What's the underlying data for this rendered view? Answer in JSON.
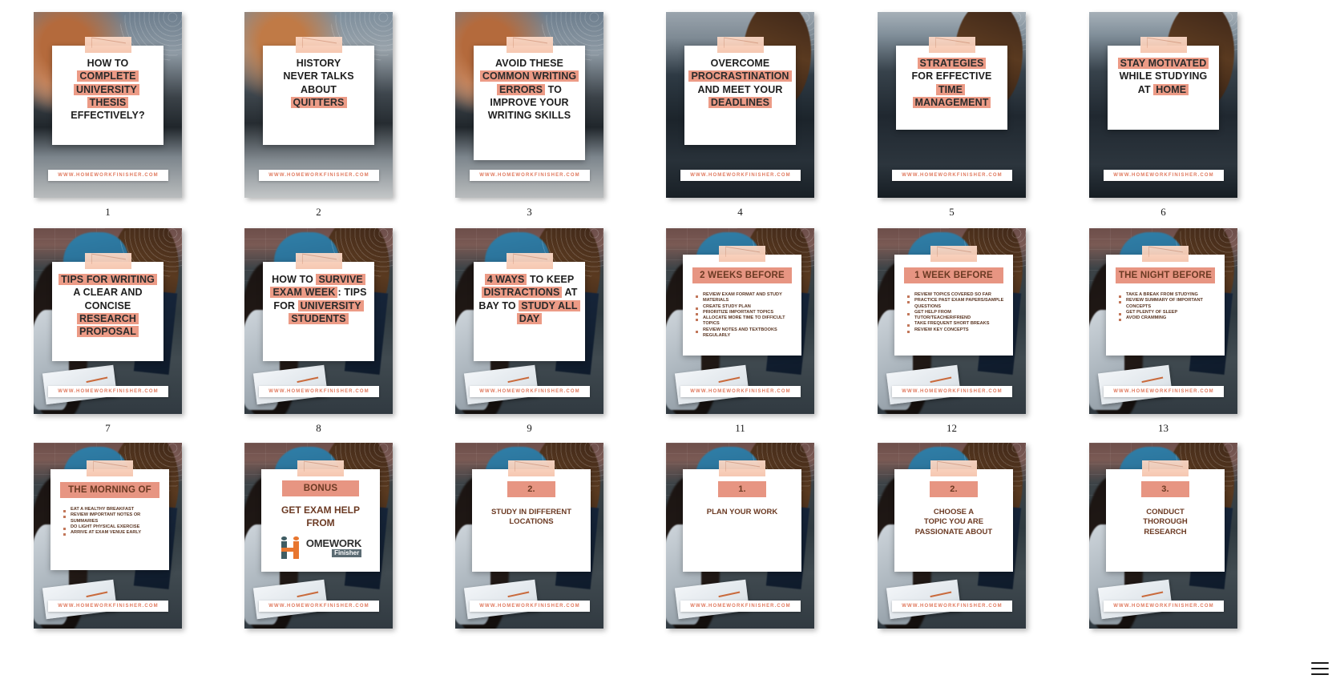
{
  "page": {
    "background": "#ffffff",
    "accent": "#e79582",
    "accent_text": "#6b3a23",
    "link_color": "#e07a5f",
    "menu_icon": "hamburger-icon"
  },
  "site_url": "WWW.HOMEWORKFINISHER.COM",
  "rows": [
    {
      "name": "row-1",
      "cards": [
        {
          "caption": "1",
          "style": "headline",
          "bg": "bg-desk",
          "lines": [
            [
              {
                "t": "HOW TO",
                "h": false
              }
            ],
            [
              {
                "t": "COMPLETE",
                "h": true
              }
            ],
            [
              {
                "t": "UNIVERSITY THESIS",
                "h": true
              }
            ],
            [
              {
                "t": "EFFECTIVELY?",
                "h": false
              }
            ]
          ]
        },
        {
          "caption": "2",
          "style": "headline",
          "bg": "bg-desk2",
          "lines": [
            [
              {
                "t": "HISTORY",
                "h": false
              }
            ],
            [
              {
                "t": "NEVER TALKS",
                "h": false
              }
            ],
            [
              {
                "t": "ABOUT",
                "h": false
              }
            ],
            [
              {
                "t": "QUITTERS",
                "h": true
              }
            ]
          ]
        },
        {
          "caption": "3",
          "style": "headline",
          "bg": "bg-desk",
          "lines": [
            [
              {
                "t": "AVOID THESE",
                "h": false
              }
            ],
            [
              {
                "t": "COMMON WRITING",
                "h": true
              }
            ],
            [
              {
                "t": "ERRORS",
                "h": true
              },
              {
                "t": " TO",
                "h": false
              }
            ],
            [
              {
                "t": "IMPROVE YOUR",
                "h": false
              }
            ],
            [
              {
                "t": "WRITING SKILLS",
                "h": false
              }
            ]
          ]
        },
        {
          "caption": "4",
          "style": "headline",
          "bg": "bg-street",
          "lines": [
            [
              {
                "t": "OVERCOME",
                "h": false
              }
            ],
            [
              {
                "t": "PROCRASTINATION",
                "h": true
              }
            ],
            [
              {
                "t": "AND MEET YOUR",
                "h": false
              }
            ],
            [
              {
                "t": "DEADLINES",
                "h": true
              }
            ]
          ]
        },
        {
          "caption": "5",
          "style": "headline",
          "bg": "bg-street2",
          "lines": [
            [
              {
                "t": "STRATEGIES",
                "h": true
              }
            ],
            [
              {
                "t": "FOR EFFECTIVE",
                "h": false
              }
            ],
            [
              {
                "t": "TIME MANAGEMENT",
                "h": true
              }
            ]
          ]
        },
        {
          "caption": "6",
          "style": "headline",
          "bg": "bg-street2",
          "lines": [
            [
              {
                "t": "STAY MOTIVATED",
                "h": true
              }
            ],
            [
              {
                "t": "WHILE STUDYING",
                "h": false
              }
            ],
            [
              {
                "t": "AT ",
                "h": false
              },
              {
                "t": "HOME",
                "h": true
              }
            ]
          ]
        }
      ]
    },
    {
      "name": "row-2",
      "cards": [
        {
          "caption": "7",
          "style": "headline",
          "bg": "bg-brick",
          "lines": [
            [
              {
                "t": "TIPS FOR WRITING",
                "h": true
              }
            ],
            [
              {
                "t": "A CLEAR AND",
                "h": false
              }
            ],
            [
              {
                "t": "CONCISE ",
                "h": false
              },
              {
                "t": "RESEARCH",
                "h": true
              }
            ],
            [
              {
                "t": "PROPOSAL",
                "h": true
              }
            ]
          ]
        },
        {
          "caption": "8",
          "style": "headline",
          "bg": "bg-brick",
          "lines": [
            [
              {
                "t": "HOW TO ",
                "h": false
              },
              {
                "t": "SURVIVE",
                "h": true
              }
            ],
            [
              {
                "t": "EXAM WEEK",
                "h": true
              },
              {
                "t": ": TIPS",
                "h": false
              }
            ],
            [
              {
                "t": "FOR ",
                "h": false
              },
              {
                "t": "UNIVERSITY",
                "h": true
              }
            ],
            [
              {
                "t": "STUDENTS",
                "h": true
              }
            ]
          ]
        },
        {
          "caption": "9",
          "style": "headline",
          "bg": "bg-brick",
          "lines": [
            [
              {
                "t": "4 WAYS",
                "h": true
              },
              {
                "t": " TO KEEP",
                "h": false
              }
            ],
            [
              {
                "t": "DISTRACTIONS",
                "h": true
              },
              {
                "t": " AT",
                "h": false
              }
            ],
            [
              {
                "t": "BAY TO ",
                "h": false
              },
              {
                "t": "STUDY ALL",
                "h": true
              }
            ],
            [
              {
                "t": "DAY",
                "h": true
              }
            ]
          ]
        },
        {
          "caption": "11",
          "style": "banner-list",
          "bg": "bg-brick",
          "banner": "2 WEEKS BEFORE",
          "bullets": [
            "REVIEW EXAM FORMAT AND STUDY MATERIALS",
            "CREATE STUDY PLAN",
            "PRIORITIZE IMPORTANT TOPICS",
            "ALLOCATE MORE TIME TO DIFFICULT TOPICS",
            "REVIEW NOTES AND TEXTBOOKS REGULARLY"
          ]
        },
        {
          "caption": "12",
          "style": "banner-list",
          "bg": "bg-brick",
          "banner": "1 WEEK BEFORE",
          "bullets": [
            "REVIEW TOPICS COVERED SO FAR",
            "PRACTICE PAST EXAM PAPERS/SAMPLE QUESTIONS",
            "GET HELP FROM TUTOR/TEACHER/FRIEND",
            "TAKE FREQUENT SHORT BREAKS",
            "REVIEW KEY CONCEPTS"
          ]
        },
        {
          "caption": "13",
          "style": "banner-list",
          "bg": "bg-brick",
          "banner": "THE NIGHT BEFORE",
          "bullets": [
            "TAKE A BREAK FROM STUDYING",
            "REVIEW SUMMARY OF IMPORTANT CONCEPTS",
            "GET PLENTY OF SLEEP",
            "AVOID CRAMMING"
          ]
        }
      ]
    },
    {
      "name": "row-3",
      "cards": [
        {
          "caption": "",
          "style": "banner-list",
          "bg": "bg-brick",
          "banner": "THE MORNING OF",
          "bullets": [
            "EAT A HEALTHY BREAKFAST",
            "REVIEW IMPORTANT NOTES OR SUMMARIES",
            "DO LIGHT PHYSICAL EXERCISE",
            "ARRIVE AT EXAM VENUE EARLY"
          ]
        },
        {
          "caption": "",
          "style": "bonus",
          "bg": "bg-brick",
          "banner": "BONUS",
          "body_lines": [
            "GET EXAM HELP",
            "FROM"
          ],
          "logo": {
            "mark": "homework-finisher-logo-icon",
            "main": "OMEWORK",
            "sub": "Finisher"
          }
        },
        {
          "caption": "",
          "style": "numbered",
          "bg": "bg-brick",
          "banner": "2.",
          "body_lines": [
            "STUDY IN DIFFERENT",
            "LOCATIONS"
          ]
        },
        {
          "caption": "",
          "style": "numbered",
          "bg": "bg-brick",
          "banner": "1.",
          "body_lines": [
            "PLAN YOUR WORK"
          ]
        },
        {
          "caption": "",
          "style": "numbered",
          "bg": "bg-brick",
          "banner": "2.",
          "body_lines": [
            "CHOOSE A",
            "TOPIC YOU ARE",
            "PASSIONATE ABOUT"
          ]
        },
        {
          "caption": "",
          "style": "numbered",
          "bg": "bg-brick",
          "banner": "3.",
          "body_lines": [
            "CONDUCT",
            "THOROUGH",
            "RESEARCH"
          ]
        }
      ]
    }
  ]
}
